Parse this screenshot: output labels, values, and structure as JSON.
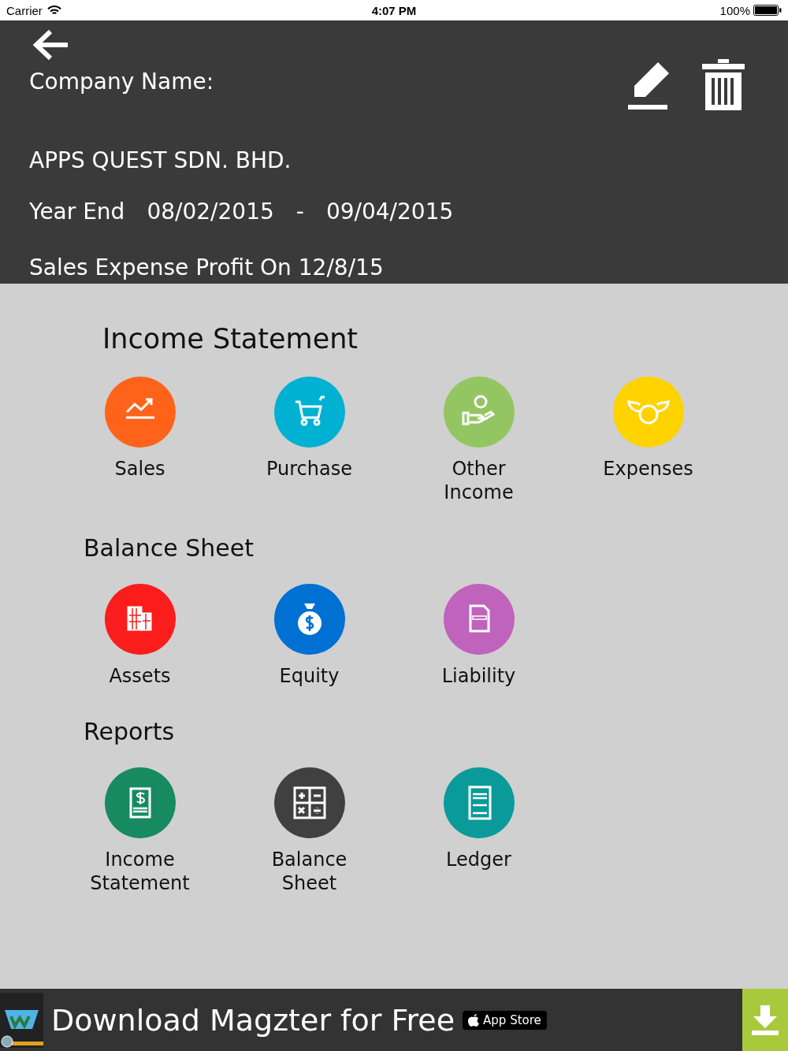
{
  "status_bar": {
    "carrier": "Carrier",
    "time": "4:07 PM",
    "battery": "100%"
  },
  "header": {
    "company_label": "Company Name:",
    "company_name": "APPS QUEST SDN. BHD.",
    "year_end_label": "Year End",
    "start_date": "08/02/2015",
    "separator": "-",
    "end_date": "09/04/2015",
    "subtitle": "Sales Expense Profit On 12/8/15"
  },
  "sections": [
    {
      "title": "Income Statement",
      "kind": "main",
      "tiles": [
        {
          "label": "Sales",
          "kind": "chart",
          "color": "#ff6319"
        },
        {
          "label": "Purchase",
          "kind": "cart",
          "color": "#00b1d2"
        },
        {
          "label": "Other Income",
          "kind": "hand",
          "color": "#93c663"
        },
        {
          "label": "Expenses",
          "kind": "wings",
          "color": "#ffd300"
        }
      ]
    },
    {
      "title": "Balance Sheet",
      "kind": "sub",
      "tiles": [
        {
          "label": "Assets",
          "kind": "building",
          "color": "#fb1c1c"
        },
        {
          "label": "Equity",
          "kind": "bag",
          "color": "#0070d3"
        },
        {
          "label": "Liability",
          "kind": "doc",
          "color": "#c063bc"
        }
      ]
    },
    {
      "title": "Reports",
      "kind": "sub",
      "tiles": [
        {
          "label": "Income Statement",
          "kind": "report",
          "color": "#178a62"
        },
        {
          "label": "Balance Sheet",
          "kind": "calc",
          "color": "#404040"
        },
        {
          "label": "Ledger",
          "kind": "ledger",
          "color": "#0b9a9a"
        }
      ]
    }
  ],
  "ad": {
    "text": "Download Magzter for Free",
    "badge": "App Store"
  }
}
